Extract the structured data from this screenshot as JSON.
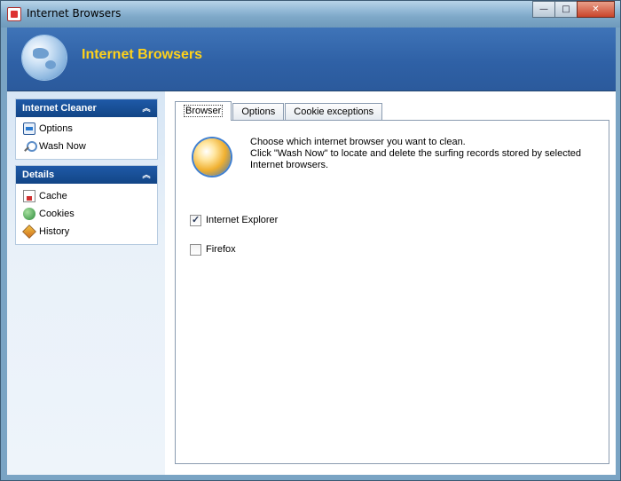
{
  "window": {
    "title": "Internet Browsers",
    "controls": {
      "minimize": "—",
      "maximize": "□",
      "close": "✕"
    }
  },
  "banner": {
    "title": "Internet Browsers"
  },
  "sidebar": {
    "groups": [
      {
        "header": "Internet Cleaner",
        "items": [
          {
            "label": "Options",
            "icon": "options-icon"
          },
          {
            "label": "Wash Now",
            "icon": "magnifier-icon"
          }
        ]
      },
      {
        "header": "Details",
        "items": [
          {
            "label": "Cache",
            "icon": "cache-icon"
          },
          {
            "label": "Cookies",
            "icon": "cookies-icon"
          },
          {
            "label": "History",
            "icon": "history-icon"
          }
        ]
      }
    ]
  },
  "main": {
    "tabs": [
      {
        "label": "Browser",
        "active": true
      },
      {
        "label": "Options",
        "active": false
      },
      {
        "label": "Cookie exceptions",
        "active": false
      }
    ],
    "description_line1": "Choose which internet browser you want to clean.",
    "description_line2": "Click \"Wash Now\" to locate and delete the surfing records stored by selected Internet browsers.",
    "browsers": [
      {
        "label": "Internet Explorer",
        "checked": true
      },
      {
        "label": "Firefox",
        "checked": false
      }
    ]
  }
}
